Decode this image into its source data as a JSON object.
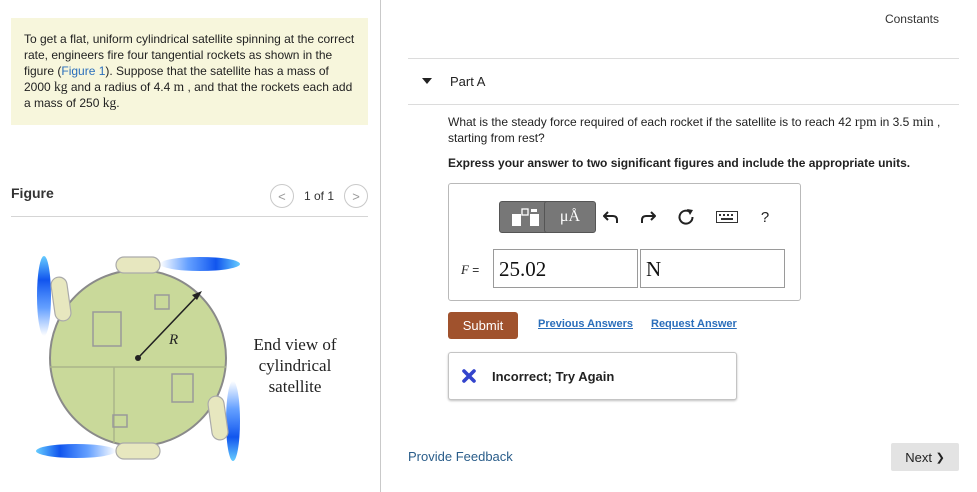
{
  "problem": {
    "text_1": "To get a flat, uniform cylindrical satellite spinning at the correct rate, engineers fire four tangential rockets as shown in the figure (",
    "figure_link": "Figure 1",
    "text_2": "). Suppose that the satellite has a mass of 2000 ",
    "unit_kg": "kg",
    "text_3": " and a radius of 4.4 ",
    "unit_m": "m",
    "text_4": " , and that the rockets each add a mass of 250 ",
    "unit_kg_2": "kg",
    "text_5": "."
  },
  "figure": {
    "title": "Figure",
    "pager_prev": "<",
    "pager_count": "1 of 1",
    "pager_next": ">",
    "radius_label": "R",
    "caption_line1": "End view of",
    "caption_line2": "cylindrical",
    "caption_line3": "satellite"
  },
  "header": {
    "constants_link": "Constants"
  },
  "part": {
    "title": "Part A",
    "question_1": "What is the steady force required of each rocket if the satellite is to reach 42 ",
    "unit_rpm": "rpm",
    "question_2": " in 3.5 ",
    "unit_min": "min",
    "question_3": " , starting from rest?",
    "instruction": "Express your answer to two significant figures and include the appropriate units."
  },
  "answer": {
    "label_var": "F",
    "label_eq": " = ",
    "value": "25.02",
    "units": "N",
    "toolbar": {
      "templates_icon": "templates-icon",
      "units_label": "μÅ",
      "undo_icon": "undo-icon",
      "redo_icon": "redo-icon",
      "reset_icon": "reset-icon",
      "keyboard_icon": "keyboard-icon",
      "help_label": "?"
    }
  },
  "actions": {
    "submit": "Submit",
    "previous_answers": "Previous Answers",
    "request_answer": "Request Answer"
  },
  "feedback": {
    "status": "Incorrect; Try Again"
  },
  "footer": {
    "provide_feedback": "Provide Feedback",
    "next": "Next",
    "next_arrow": "❯"
  },
  "colors": {
    "problem_bg": "#f7f6dc",
    "link": "#2a6ebb",
    "submit_bg": "#a0522d",
    "incorrect_icon": "#3344cc",
    "satellite_fill": "#c9d99a",
    "rocket_flame": "#2277ff"
  }
}
